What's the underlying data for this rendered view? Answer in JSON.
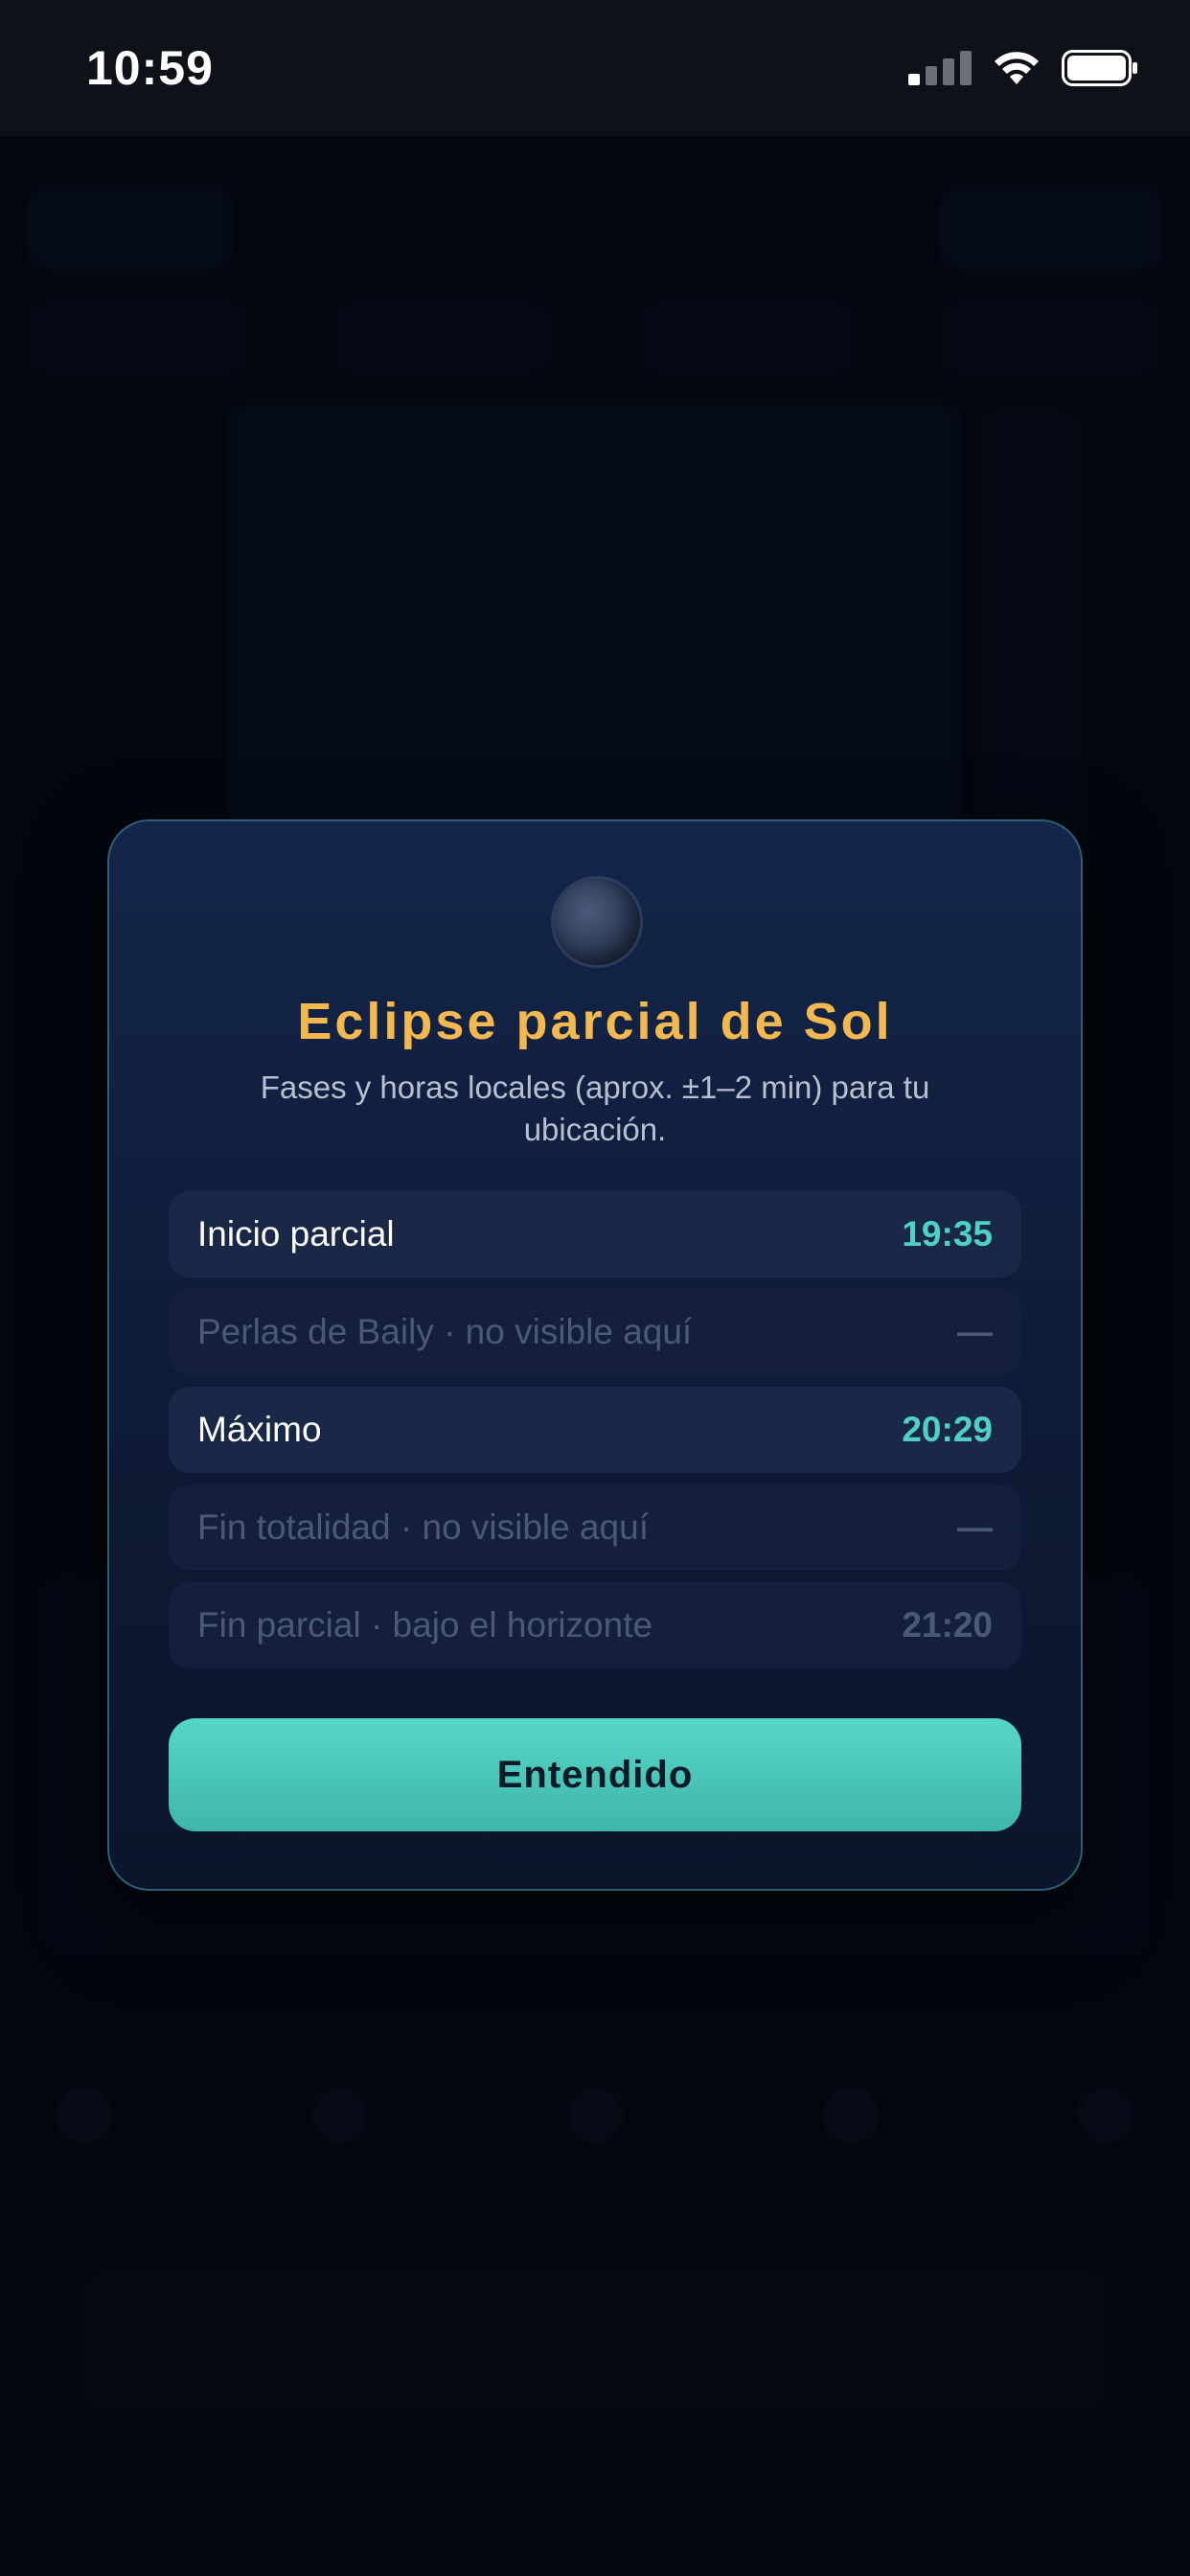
{
  "status_bar": {
    "time": "10:59",
    "icons": [
      "cellular-signal-icon",
      "wifi-icon",
      "battery-icon"
    ]
  },
  "modal": {
    "icon": "partial-eclipse-icon",
    "title": "Eclipse parcial de Sol",
    "subtitle": "Fases y horas locales (aprox. ±1–2 min) para tu ubicación.",
    "phases": [
      {
        "label": "Inicio parcial",
        "time": "19:35",
        "visible": true
      },
      {
        "label": "Perlas de Baily · no visible aquí",
        "time": "—",
        "visible": false
      },
      {
        "label": "Máximo",
        "time": "20:29",
        "visible": true
      },
      {
        "label": "Fin totalidad · no visible aquí",
        "time": "—",
        "visible": false
      },
      {
        "label": "Fin parcial · bajo el horizonte",
        "time": "21:20",
        "visible": false
      }
    ],
    "confirm_label": "Entendido"
  },
  "colors": {
    "title": "#f3b84f",
    "accent": "#4fd1c5",
    "modal_bg": "#14254a",
    "button": "#56d6c8"
  }
}
